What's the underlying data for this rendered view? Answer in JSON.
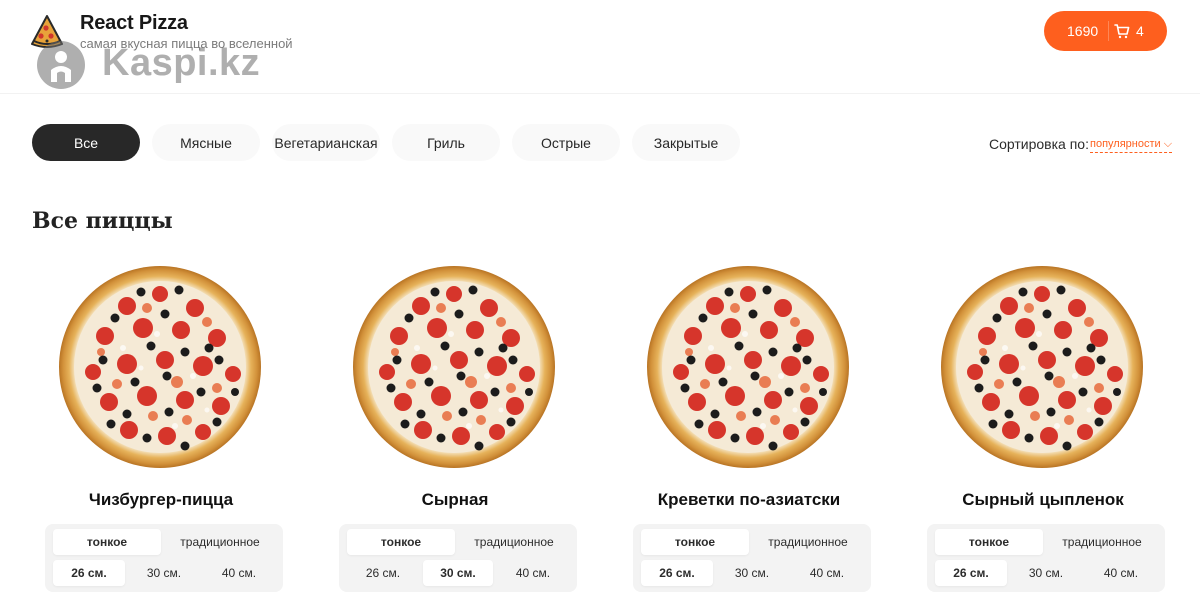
{
  "header": {
    "title": "React Pizza",
    "subtitle": "самая вкусная пицца во вселенной",
    "watermark": "Kaspi.kz"
  },
  "cart": {
    "price": "1690",
    "count": "4"
  },
  "categories": [
    "Все",
    "Мясные",
    "Вегетарианская",
    "Гриль",
    "Острые",
    "Закрытые"
  ],
  "active_category": "Все",
  "sort": {
    "label": "Сортировка по:",
    "value": "популярности"
  },
  "section_title": "Все пиццы",
  "products": [
    {
      "name": "Чизбургер-пицца",
      "types": [
        "тонкое",
        "традиционное"
      ],
      "sizes": [
        "26 см.",
        "30 см.",
        "40 см."
      ],
      "selected_type": "тонкое",
      "selected_size": "26 см."
    },
    {
      "name": "Сырная",
      "types": [
        "тонкое",
        "традиционное"
      ],
      "sizes": [
        "26 см.",
        "30 см.",
        "40 см."
      ],
      "selected_type": "тонкое",
      "selected_size": "30 см."
    },
    {
      "name": "Креветки по-азиатски",
      "types": [
        "тонкое",
        "традиционное"
      ],
      "sizes": [
        "26 см.",
        "30 см.",
        "40 см."
      ],
      "selected_type": "тонкое",
      "selected_size": "26 см."
    },
    {
      "name": "Сырный цыпленок",
      "types": [
        "тонкое",
        "традиционное"
      ],
      "sizes": [
        "26 см.",
        "30 см.",
        "40 см."
      ],
      "selected_type": "тонкое",
      "selected_size": "26 см."
    }
  ],
  "colors": {
    "accent": "#fe5f1e",
    "dark": "#282828",
    "pill_bg": "#f9f9f9"
  },
  "icons": {
    "logo": "pizza-slice-icon",
    "cart": "cart-icon",
    "sort_arrow": "chevron-down-icon"
  }
}
